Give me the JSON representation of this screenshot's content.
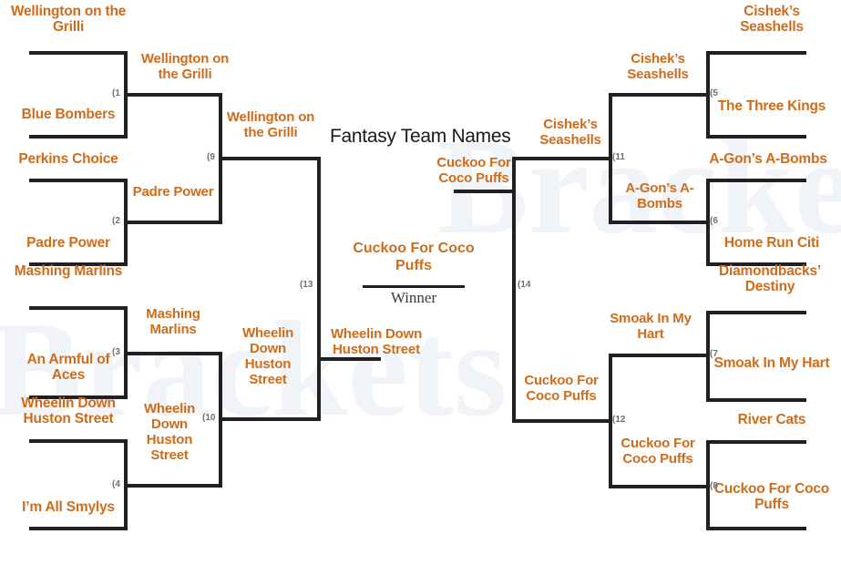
{
  "title": "Fantasy Team Names",
  "watermark": "Brackets",
  "colors": {
    "team_text": "#cf6c1a",
    "line": "#231f20",
    "game_number": "#6e6e6e",
    "title_text": "#1a1a1a",
    "winner_label": "#3a3a3a",
    "background": "#ffffff"
  },
  "winner": {
    "team": "Cuckoo For Coco Puffs",
    "label": "Winner"
  },
  "game_numbers": {
    "g1": "(1",
    "g2": "(2",
    "g3": "(3",
    "g4": "(4",
    "g5": "(5",
    "g6": "(6",
    "g7": "(7",
    "g8": "(8",
    "g9": "(9",
    "g10": "(10",
    "g11": "(11",
    "g12": "(12",
    "g13": "(13",
    "g14": "(14"
  },
  "left": {
    "round1": [
      {
        "top": "Wellington on the Grilli",
        "bottom": "Blue Bombers"
      },
      {
        "top": "Perkins Choice",
        "bottom": "Padre Power"
      },
      {
        "top": "Mashing Marlins",
        "bottom": "An Armful of Aces"
      },
      {
        "top": "Wheelin Down Huston Street",
        "bottom": "I’m All Smylys"
      }
    ],
    "round2": [
      "Wellington on the Grilli",
      "Padre Power",
      "Mashing Marlins",
      "Wheelin Down Huston Street"
    ],
    "round3": [
      "Wellington on the Grilli",
      "Wheelin Down Huston Street"
    ],
    "round4": "Wheelin Down Huston Street"
  },
  "right": {
    "round1": [
      {
        "top": "Cishek’s Seashells",
        "bottom": "The Three Kings"
      },
      {
        "top": "A-Gon’s A-Bombs",
        "bottom": "Home Run Citi"
      },
      {
        "top": "Diamondbacks’ Destiny",
        "bottom": "Smoak In My Hart"
      },
      {
        "top": "River Cats",
        "bottom": "Cuckoo For Coco Puffs"
      }
    ],
    "round2": [
      "Cishek’s Seashells",
      "A-Gon’s A-Bombs",
      "Smoak In My Hart",
      "Cuckoo For Coco Puffs"
    ],
    "round3": [
      "Cishek’s Seashells",
      "Cuckoo For Coco Puffs"
    ],
    "round4": "Cuckoo For Coco Puffs"
  },
  "chart_data": {
    "type": "diagram",
    "diagram_type": "single-elimination-bracket",
    "title": "Fantasy Team Names",
    "teams": 16,
    "rounds": 4,
    "matches": [
      {
        "id": 1,
        "side": "left",
        "round": 1,
        "competitors": [
          "Wellington on the Grilli",
          "Blue Bombers"
        ],
        "winner": "Wellington on the Grilli"
      },
      {
        "id": 2,
        "side": "left",
        "round": 1,
        "competitors": [
          "Perkins Choice",
          "Padre Power"
        ],
        "winner": "Padre Power"
      },
      {
        "id": 3,
        "side": "left",
        "round": 1,
        "competitors": [
          "Mashing Marlins",
          "An Armful of Aces"
        ],
        "winner": "Mashing Marlins"
      },
      {
        "id": 4,
        "side": "left",
        "round": 1,
        "competitors": [
          "Wheelin Down Huston Street",
          "I’m All Smylys"
        ],
        "winner": "Wheelin Down Huston Street"
      },
      {
        "id": 5,
        "side": "right",
        "round": 1,
        "competitors": [
          "Cishek’s Seashells",
          "The Three Kings"
        ],
        "winner": "Cishek’s Seashells"
      },
      {
        "id": 6,
        "side": "right",
        "round": 1,
        "competitors": [
          "A-Gon’s A-Bombs",
          "Home Run Citi"
        ],
        "winner": "A-Gon’s A-Bombs"
      },
      {
        "id": 7,
        "side": "right",
        "round": 1,
        "competitors": [
          "Diamondbacks’ Destiny",
          "Smoak In My Hart"
        ],
        "winner": "Smoak In My Hart"
      },
      {
        "id": 8,
        "side": "right",
        "round": 1,
        "competitors": [
          "River Cats",
          "Cuckoo For Coco Puffs"
        ],
        "winner": "Cuckoo For Coco Puffs"
      },
      {
        "id": 9,
        "side": "left",
        "round": 2,
        "competitors": [
          "Wellington on the Grilli",
          "Padre Power"
        ],
        "winner": "Wellington on the Grilli"
      },
      {
        "id": 10,
        "side": "left",
        "round": 2,
        "competitors": [
          "Mashing Marlins",
          "Wheelin Down Huston Street"
        ],
        "winner": "Wheelin Down Huston Street"
      },
      {
        "id": 11,
        "side": "right",
        "round": 2,
        "competitors": [
          "Cishek’s Seashells",
          "A-Gon’s A-Bombs"
        ],
        "winner": "Cishek’s Seashells"
      },
      {
        "id": 12,
        "side": "right",
        "round": 2,
        "competitors": [
          "Smoak In My Hart",
          "Cuckoo For Coco Puffs"
        ],
        "winner": "Cuckoo For Coco Puffs"
      },
      {
        "id": 13,
        "side": "left",
        "round": 3,
        "competitors": [
          "Wellington on the Grilli",
          "Wheelin Down Huston Street"
        ],
        "winner": "Wheelin Down Huston Street"
      },
      {
        "id": 14,
        "side": "right",
        "round": 3,
        "competitors": [
          "Cishek’s Seashells",
          "Cuckoo For Coco Puffs"
        ],
        "winner": "Cuckoo For Coco Puffs"
      },
      {
        "id": 15,
        "side": "final",
        "round": 4,
        "competitors": [
          "Wheelin Down Huston Street",
          "Cuckoo For Coco Puffs"
        ],
        "winner": "Cuckoo For Coco Puffs"
      }
    ],
    "champion": "Cuckoo For Coco Puffs"
  }
}
